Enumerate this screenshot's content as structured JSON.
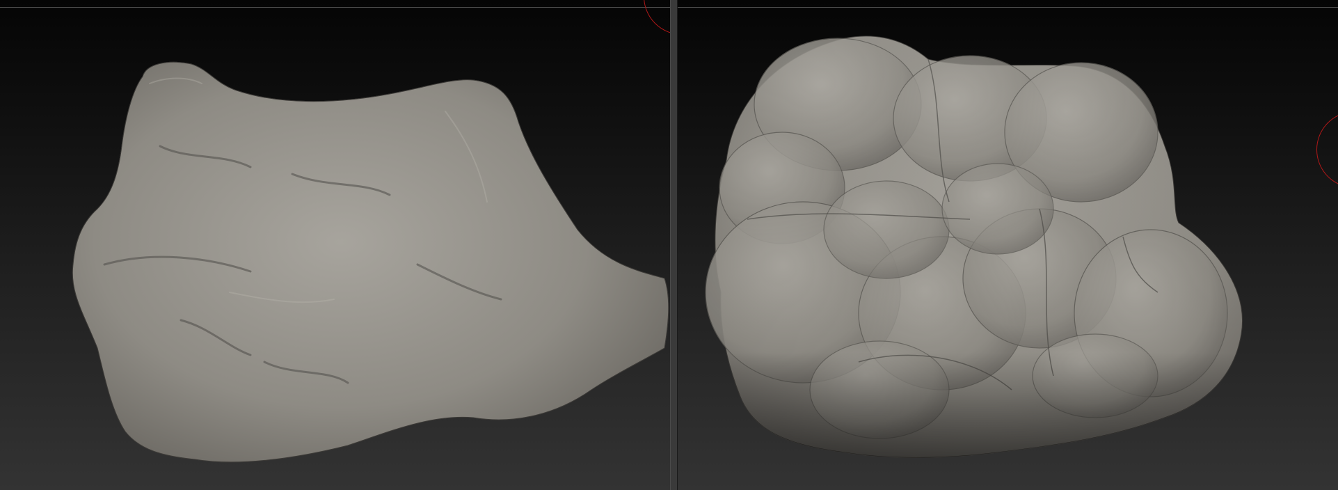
{
  "app": {
    "name": "",
    "accent_color": "#b01818",
    "background_gradient": [
      "#050505",
      "#333333"
    ],
    "mesh_color": "#8f8c86"
  },
  "viewports": [
    {
      "id": "left",
      "content": "rock-sculpt-detailed",
      "icon": "rock-mesh-icon"
    },
    {
      "id": "right",
      "content": "rock-sculpt-blocked-out",
      "icon": "rock-mesh-icon"
    }
  ]
}
